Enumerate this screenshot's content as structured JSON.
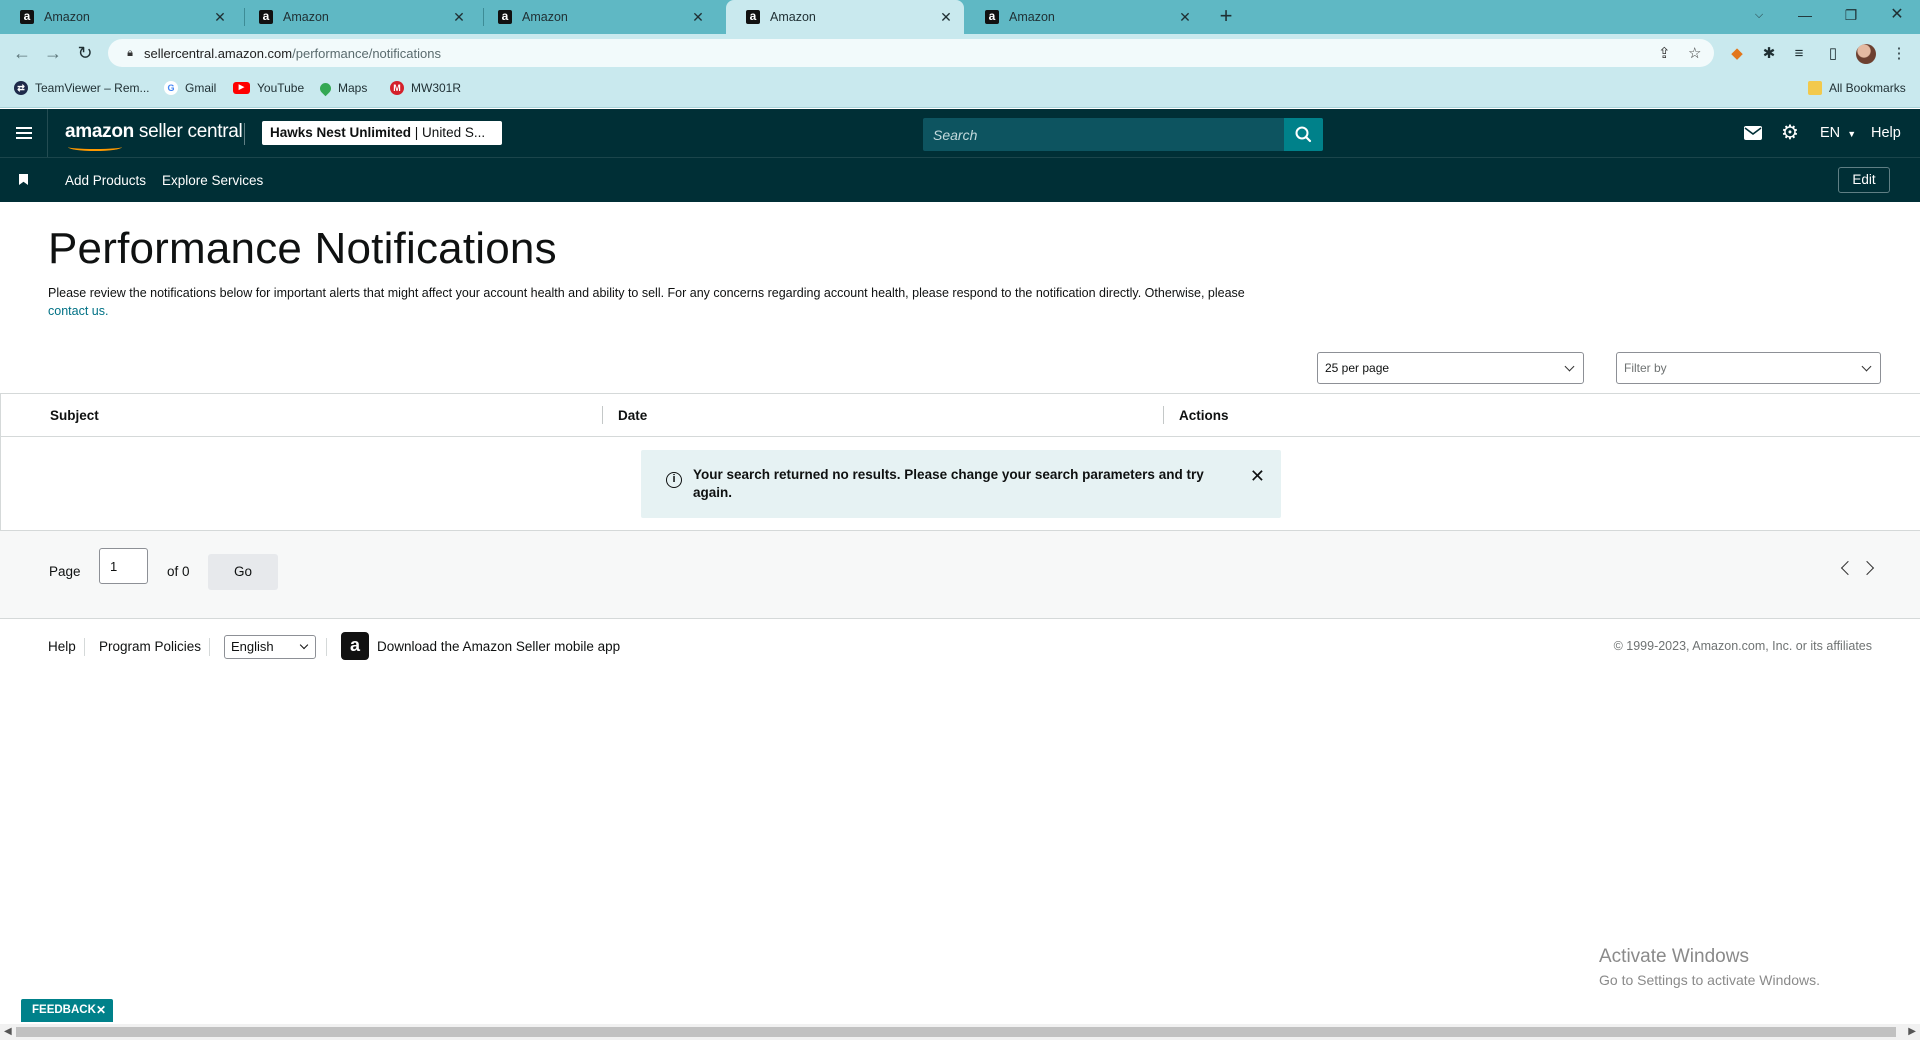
{
  "browser": {
    "tabs": [
      {
        "title": "Amazon",
        "active": false
      },
      {
        "title": "Amazon",
        "active": false
      },
      {
        "title": "Amazon",
        "active": false
      },
      {
        "title": "Amazon",
        "active": true
      },
      {
        "title": "Amazon",
        "active": false
      }
    ],
    "url_host": "sellercentral.amazon.com",
    "url_path": "/performance/notifications",
    "bookmarks": [
      {
        "label": "TeamViewer – Rem...",
        "icon": "teamviewer-icon"
      },
      {
        "label": "Gmail",
        "icon": "google-icon"
      },
      {
        "label": "YouTube",
        "icon": "youtube-icon"
      },
      {
        "label": "Maps",
        "icon": "maps-icon"
      },
      {
        "label": "MW301R",
        "icon": "router-icon"
      }
    ],
    "all_bookmarks": "All Bookmarks"
  },
  "header": {
    "logo_brand": "amazon",
    "logo_suffix": " seller central",
    "store_name": "Hawks Nest Unlimited",
    "store_region": " | United S...",
    "search_placeholder": "Search",
    "language": "EN",
    "help": "Help"
  },
  "subnav": {
    "items": [
      "Add Products",
      "Explore Services"
    ],
    "edit": "Edit"
  },
  "main": {
    "title": "Performance Notifications",
    "description": "Please review the notifications below for important alerts that might affect your account health and ability to sell. For any concerns regarding account health, please respond to the notification directly. Otherwise, please ",
    "contact_link": "contact us.",
    "per_page": "25 per page",
    "filter_placeholder": "Filter by",
    "columns": [
      "Subject",
      "Date",
      "Actions"
    ],
    "empty_message": "Your search returned no results. Please change your search parameters and try again."
  },
  "pager": {
    "page_label": "Page",
    "page_value": "1",
    "of_label": "of 0",
    "go": "Go"
  },
  "footer": {
    "help": "Help",
    "program_policies": "Program Policies",
    "language": "English",
    "app_text": "Download the Amazon Seller mobile app",
    "copyright": "© 1999-2023, Amazon.com, Inc. or its affiliates"
  },
  "windows": {
    "activate_title": "Activate Windows",
    "activate_sub": "Go to Settings to activate Windows."
  },
  "feedback": "FEEDBACK",
  "colors": {
    "header_bg": "#002f36",
    "accent": "#00818a",
    "link": "#007185",
    "tabstrip": "#5fb8c4"
  }
}
